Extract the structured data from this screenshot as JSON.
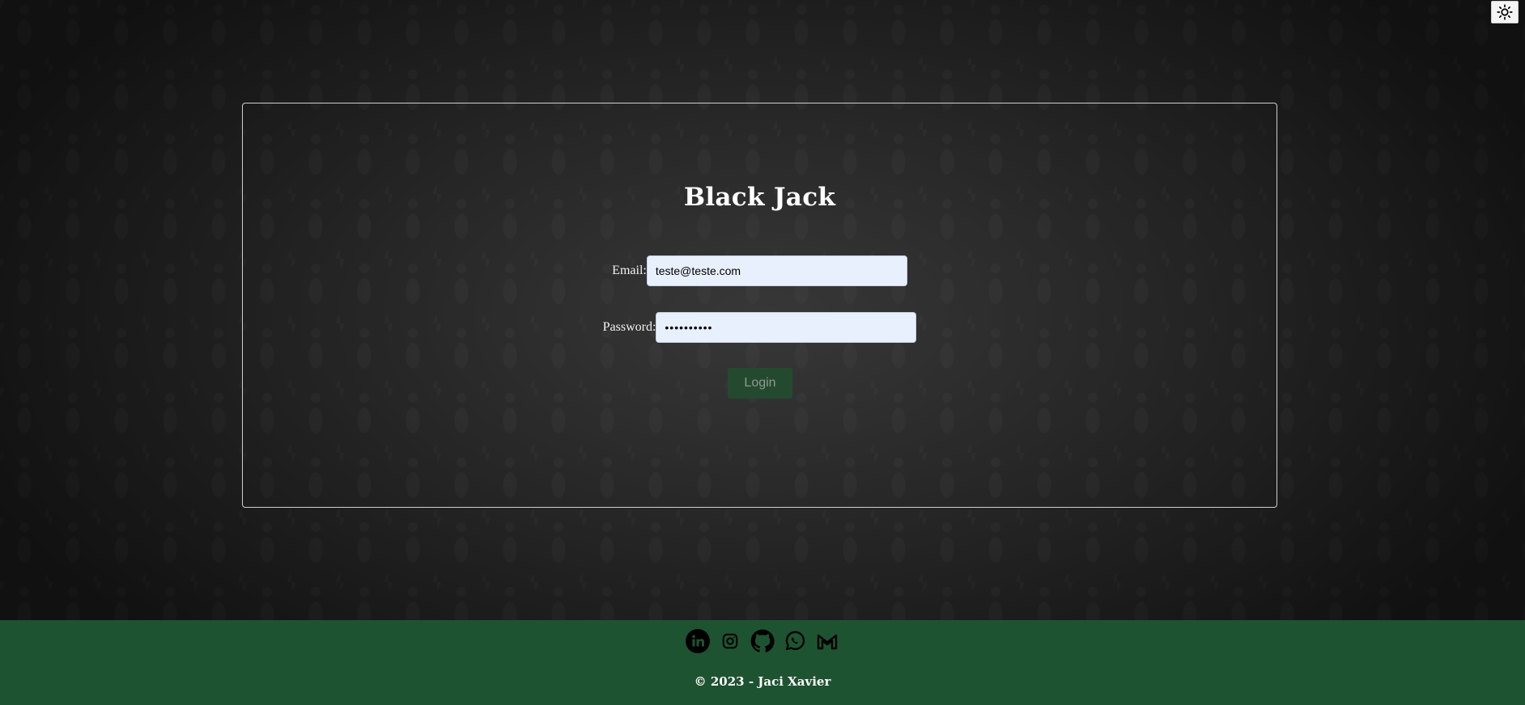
{
  "theme_toggle": {
    "icon": "sun-icon"
  },
  "login_form": {
    "title": "Black Jack",
    "email_label": "Email:",
    "email_value": "teste@teste.com",
    "password_label": "Password:",
    "password_value": "••••••••••",
    "login_label": "Login"
  },
  "footer": {
    "social_links": [
      {
        "name": "linkedin",
        "icon": "linkedin-icon"
      },
      {
        "name": "instagram",
        "icon": "instagram-icon"
      },
      {
        "name": "github",
        "icon": "github-icon"
      },
      {
        "name": "whatsapp",
        "icon": "whatsapp-icon"
      },
      {
        "name": "gmail",
        "icon": "gmail-icon"
      }
    ],
    "copyright": "© 2023 - Jaci Xavier"
  },
  "colors": {
    "footer_bg": "#1e5331",
    "button_bg": "#234a2f",
    "input_bg": "#e8f0fe",
    "text": "#ffffff"
  }
}
